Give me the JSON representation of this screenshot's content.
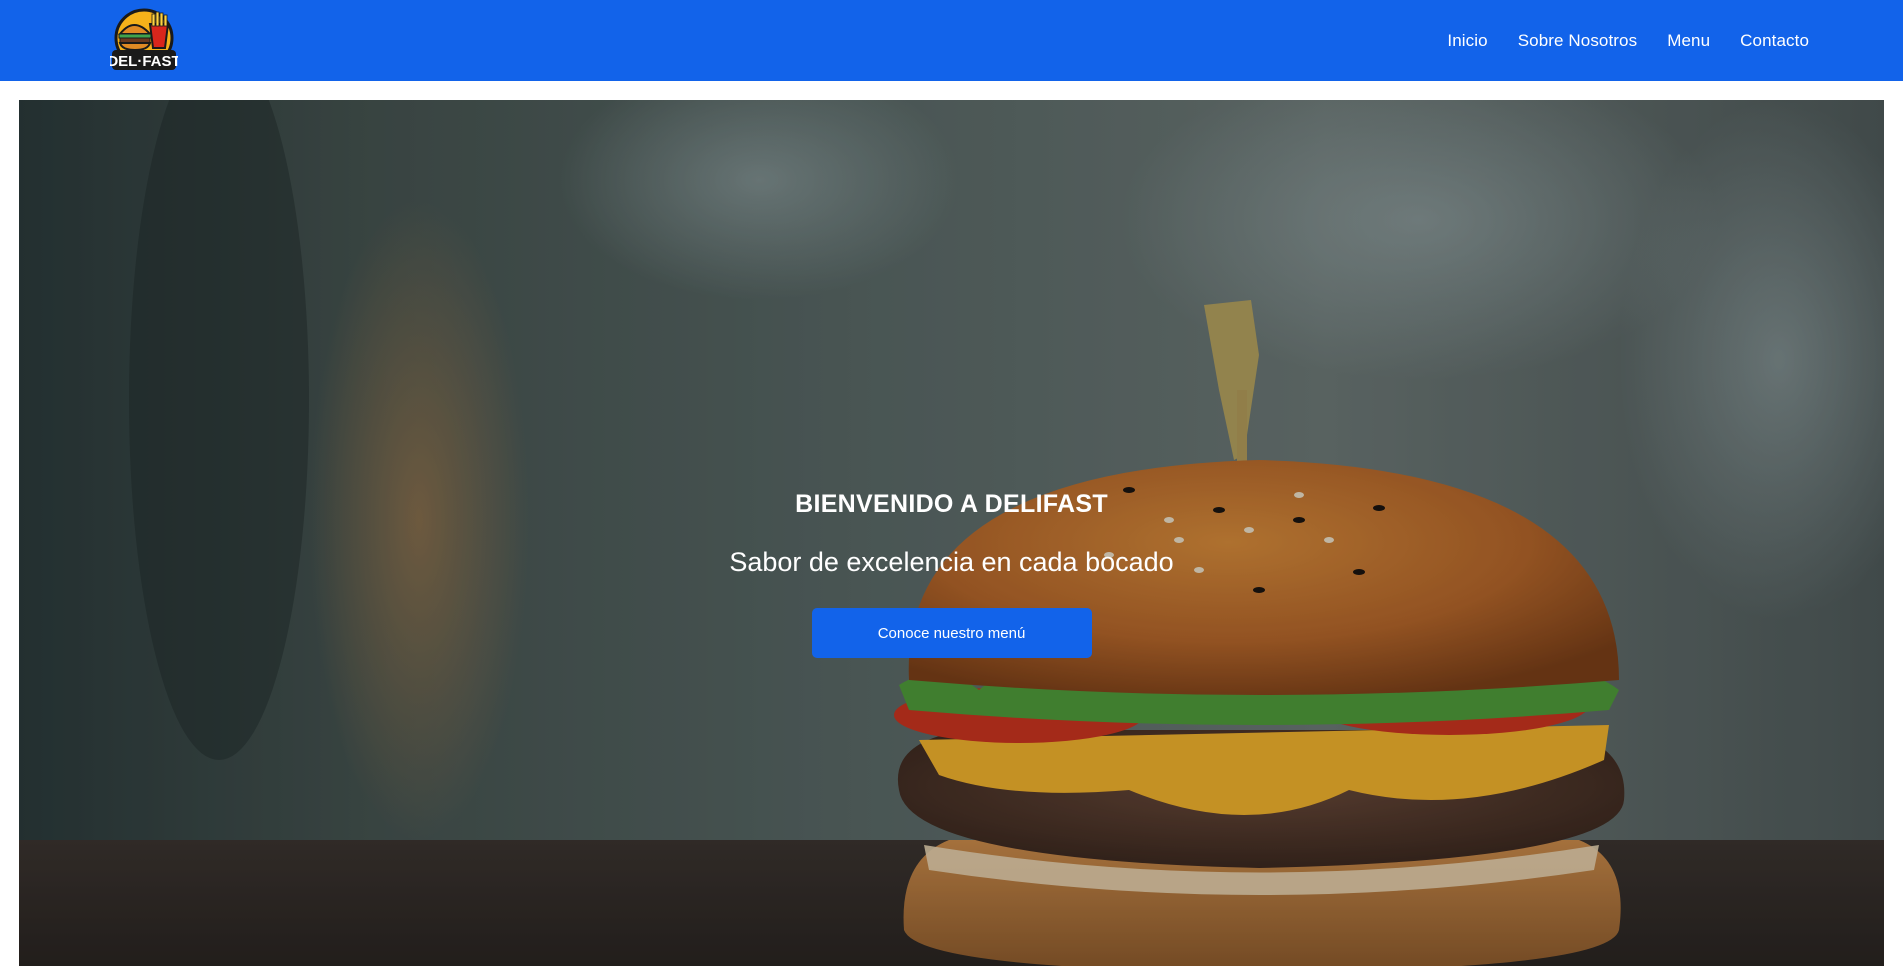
{
  "colors": {
    "brand_blue": "#1263ea",
    "text_white": "#ffffff"
  },
  "header": {
    "logo_text": "DEL·FAST",
    "nav": [
      {
        "label": "Inicio"
      },
      {
        "label": "Sobre Nosotros"
      },
      {
        "label": "Menu"
      },
      {
        "label": "Contacto"
      }
    ]
  },
  "hero": {
    "title": "BIENVENIDO A DELIFAST",
    "subtitle": "Sabor de excelencia en cada bocado",
    "cta_label": "Conoce nuestro menú",
    "background_image": "burger-photo"
  }
}
